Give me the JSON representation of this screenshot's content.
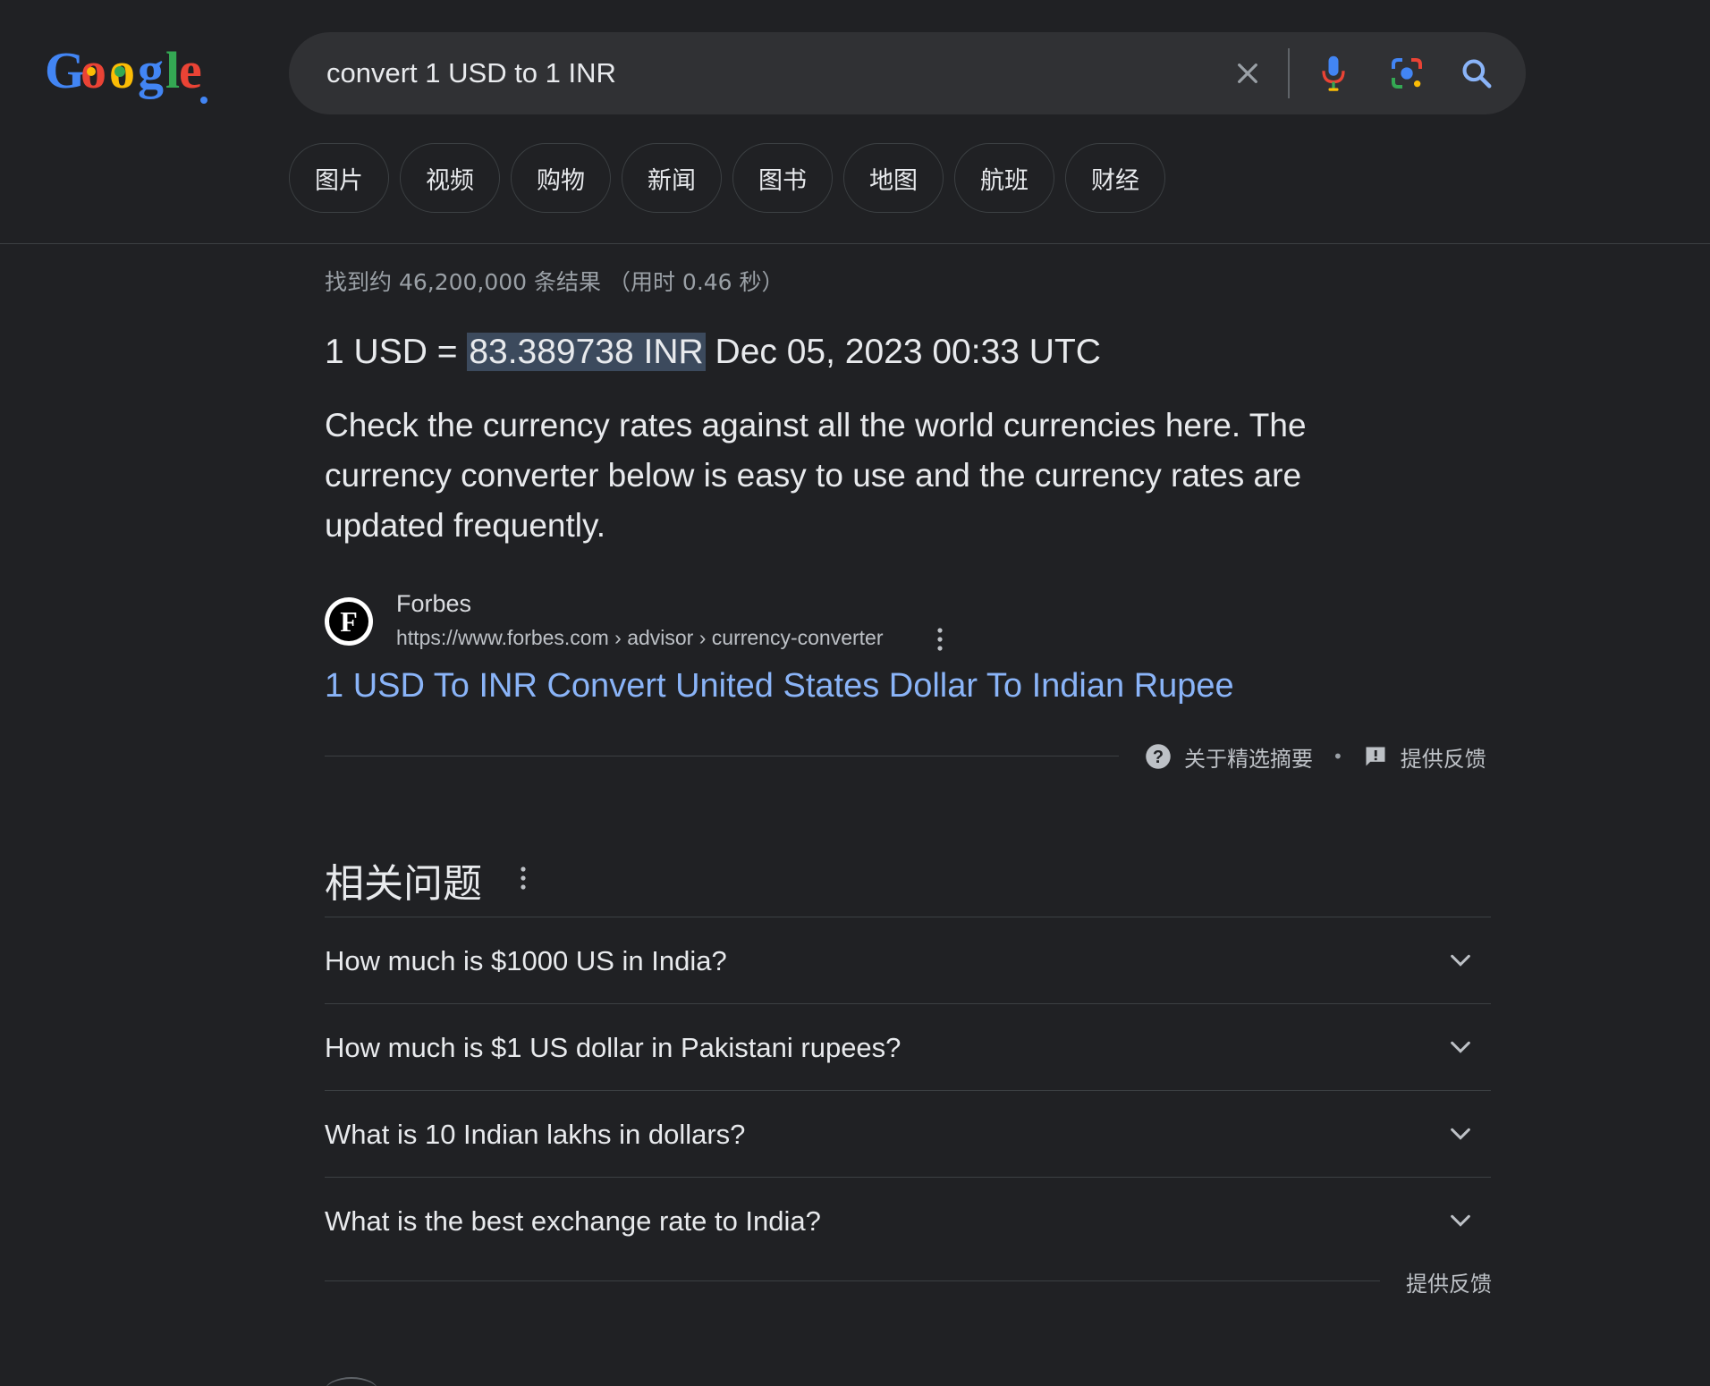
{
  "search": {
    "query": "convert 1 USD to 1 INR",
    "clear_icon": "close-icon",
    "mic_icon": "microphone-icon",
    "lens_icon": "camera-lens-icon",
    "search_icon": "search-icon"
  },
  "chips": [
    "图片",
    "视频",
    "购物",
    "新闻",
    "图书",
    "地图",
    "航班",
    "财经"
  ],
  "stats": "找到约 46,200,000 条结果 （用时 0.46 秒）",
  "featured": {
    "answer_prefix": "1 USD = ",
    "answer_highlight": "83.389738 INR",
    "answer_suffix": " Dec 05, 2023 00:33 UTC",
    "snippet": "Check the currency rates against all the world currencies here. The currency converter below is easy to use and the currency rates are updated frequently.",
    "source": {
      "favicon_letter": "F",
      "name": "Forbes",
      "url": "https://www.forbes.com › advisor › currency-converter"
    },
    "title": "1 USD To INR Convert United States Dollar To Indian Rupee",
    "footer": {
      "about": "关于精选摘要",
      "feedback": "提供反馈"
    }
  },
  "people_also_ask": {
    "title": "相关问题",
    "questions": [
      "How much is $1000 US in India?",
      "How much is $1 US dollar in Pakistani rupees?",
      "What is 10 Indian lakhs in dollars?",
      "What is the best exchange rate to India?"
    ],
    "feedback": "提供反馈"
  },
  "colors": {
    "background": "#202124",
    "searchbar": "#303134",
    "link": "#8ab4f8",
    "highlight": "#3c4a5d"
  }
}
